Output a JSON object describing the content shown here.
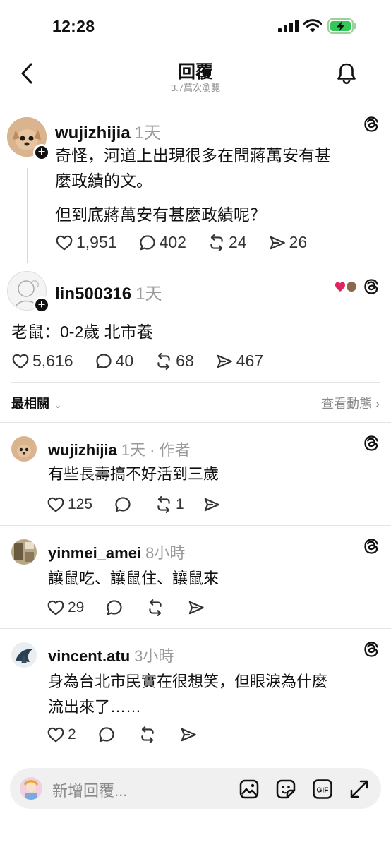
{
  "status_bar": {
    "time": "12:28"
  },
  "header": {
    "title": "回覆",
    "views": "3.7萬次瀏覽"
  },
  "main_post": {
    "username": "wujizhijia",
    "time": "1天",
    "text_line1": "奇怪，河道上出現很多在問蔣萬安有甚",
    "text_line2": "麼政績的文。",
    "text_line3": "但到底蔣萬安有甚麼政績呢？",
    "likes": "1,951",
    "comments": "402",
    "reposts": "24",
    "shares": "26"
  },
  "reply_post": {
    "username": "lin500316",
    "time": "1天",
    "text": "老鼠：0-2歲 北市養",
    "likes": "5,616",
    "comments": "40",
    "reposts": "68",
    "shares": "467"
  },
  "sort": {
    "label": "最相關",
    "activity": "查看動態"
  },
  "replies": [
    {
      "username": "wujizhijia",
      "meta": "1天 · 作者",
      "text": "有些長壽搞不好活到三歲",
      "likes": "125",
      "comments": "",
      "reposts": "1",
      "shares": ""
    },
    {
      "username": "yinmei_amei",
      "meta": "8小時",
      "text": "讓鼠吃、讓鼠住、讓鼠來",
      "likes": "29",
      "comments": "",
      "reposts": "",
      "shares": ""
    },
    {
      "username": "vincent.atu",
      "meta": "3小時",
      "text_line1": "身為台北市民實在很想笑，但眼淚為什麼",
      "text_line2": "流出來了……",
      "likes": "2",
      "comments": "",
      "reposts": "",
      "shares": ""
    }
  ],
  "composer": {
    "placeholder": "新增回覆..."
  },
  "colors": {
    "accent": "#111111",
    "muted": "#8a8a8a",
    "like_red": "#e0245e"
  }
}
